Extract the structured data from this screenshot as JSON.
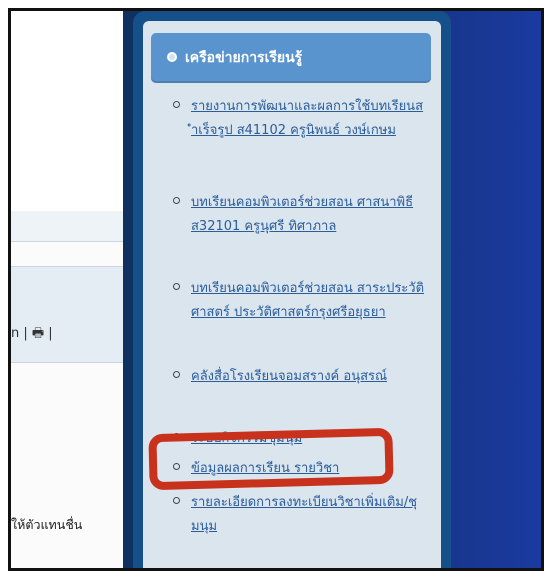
{
  "left": {
    "toolbar_text": "n | 🖶 |",
    "bottom_text": "ให้ตัวแทนชื่น"
  },
  "sidebar": {
    "header_title": "เครือข่ายการเรียนรู้",
    "links": [
      {
        "label": "รายงานการพัฒนาและผลการใช้บทเรียนสำเร็จรูป ส41102 ครูนิพนธ์ วงษ์เกษม"
      },
      {
        "label": "บทเรียนคอมพิวเตอร์ช่วยสอน ศาสนาพิธี ส32101 ครูนุศรี ทิศาภาล"
      },
      {
        "label": "บทเรียนคอมพิวเตอร์ช่วยสอน สาระประวัติศาสตร์ ประวัติศาสตร์กรุงศรีอยุธยา"
      },
      {
        "label": "คลังสื่อโรงเรียนจอมสรางค์ อนุสรณ์"
      },
      {
        "label": "ระบบกิจกรรมชุมนุม"
      },
      {
        "label": "ข้อมูลผลการเรียน รายวิชา"
      },
      {
        "label": "รายละเอียดการลงทะเบียนวิชาเพิ่มเติม/ชุมนุม"
      }
    ]
  },
  "annotation": {
    "highlight_color": "#c8321c",
    "highlighted_item": "ระบบกิจกรรมชุมนุม"
  }
}
